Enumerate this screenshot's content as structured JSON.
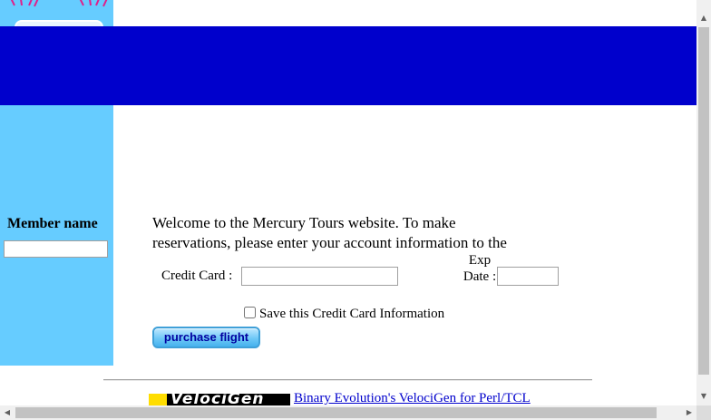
{
  "sidebar": {
    "member_label": "Member name",
    "member_value": ""
  },
  "main": {
    "welcome_text": "Welcome to the Mercury Tours website. To make reservations, please enter your account information to the left.",
    "credit_card_label": "Credit Card :",
    "credit_card_value": "",
    "exp_date_label": "Exp Date :",
    "exp_date_value": "",
    "save_card_label": "Save this Credit Card Information",
    "save_card_checked": false,
    "purchase_button_label": "purchase flight"
  },
  "ad": {
    "banner_text": "VelociGen",
    "link_text": "Binary Evolution's VelociGen for Perl/TCL"
  },
  "colors": {
    "sidebar": "#66ccff",
    "topbar": "#0000cc",
    "link": "#0000cc"
  }
}
